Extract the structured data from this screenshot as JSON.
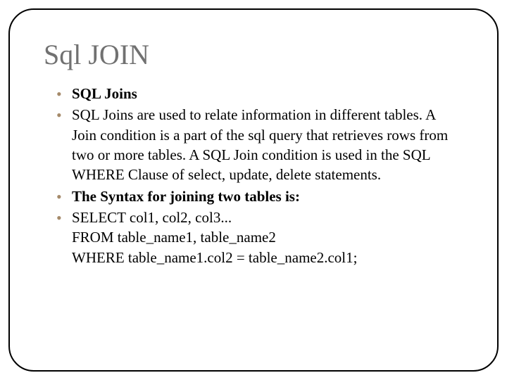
{
  "title": "Sql JOIN",
  "bullets": [
    {
      "text": "SQL Joins",
      "bold": true
    },
    {
      "text": "SQL Joins are used to relate information in different tables. A Join condition is a part of the sql query that retrieves rows from two or more tables. A SQL Join condition is used in the SQL WHERE Clause of select, update, delete statements.",
      "bold": false
    },
    {
      "text": "The Syntax for joining two tables is:",
      "bold": true
    },
    {
      "text": "SELECT col1, col2, col3...\nFROM table_name1, table_name2\nWHERE table_name1.col2 = table_name2.col1;",
      "bold": false
    }
  ]
}
